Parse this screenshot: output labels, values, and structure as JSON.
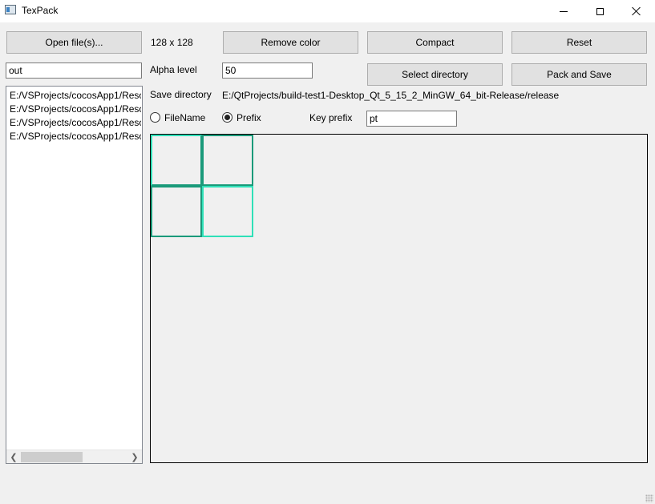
{
  "window": {
    "title": "TexPack",
    "icon": "app-window-icon"
  },
  "toolbar": {
    "open_label": "Open file(s)...",
    "size_text": "128 x 128",
    "remove_color_label": "Remove color",
    "compact_label": "Compact",
    "reset_label": "Reset",
    "select_directory_label": "Select directory",
    "pack_save_label": "Pack and Save"
  },
  "output": {
    "name_value": "out"
  },
  "alpha": {
    "label": "Alpha level",
    "value": "50"
  },
  "save_dir": {
    "label": "Save directory",
    "path": "E:/QtProjects/build-test1-Desktop_Qt_5_15_2_MinGW_64_bit-Release/release"
  },
  "naming": {
    "filename_label": "FileName",
    "prefix_label": "Prefix",
    "selected": "Prefix",
    "key_prefix_label": "Key prefix",
    "key_prefix_value": "pt"
  },
  "files": [
    "E:/VSProjects/cocosApp1/Reso",
    "E:/VSProjects/cocosApp1/Reso",
    "E:/VSProjects/cocosApp1/Reso",
    "E:/VSProjects/cocosApp1/Reso"
  ],
  "colors": {
    "tile_dark": "#1a9a7a",
    "tile_light": "#2fe0b8"
  }
}
